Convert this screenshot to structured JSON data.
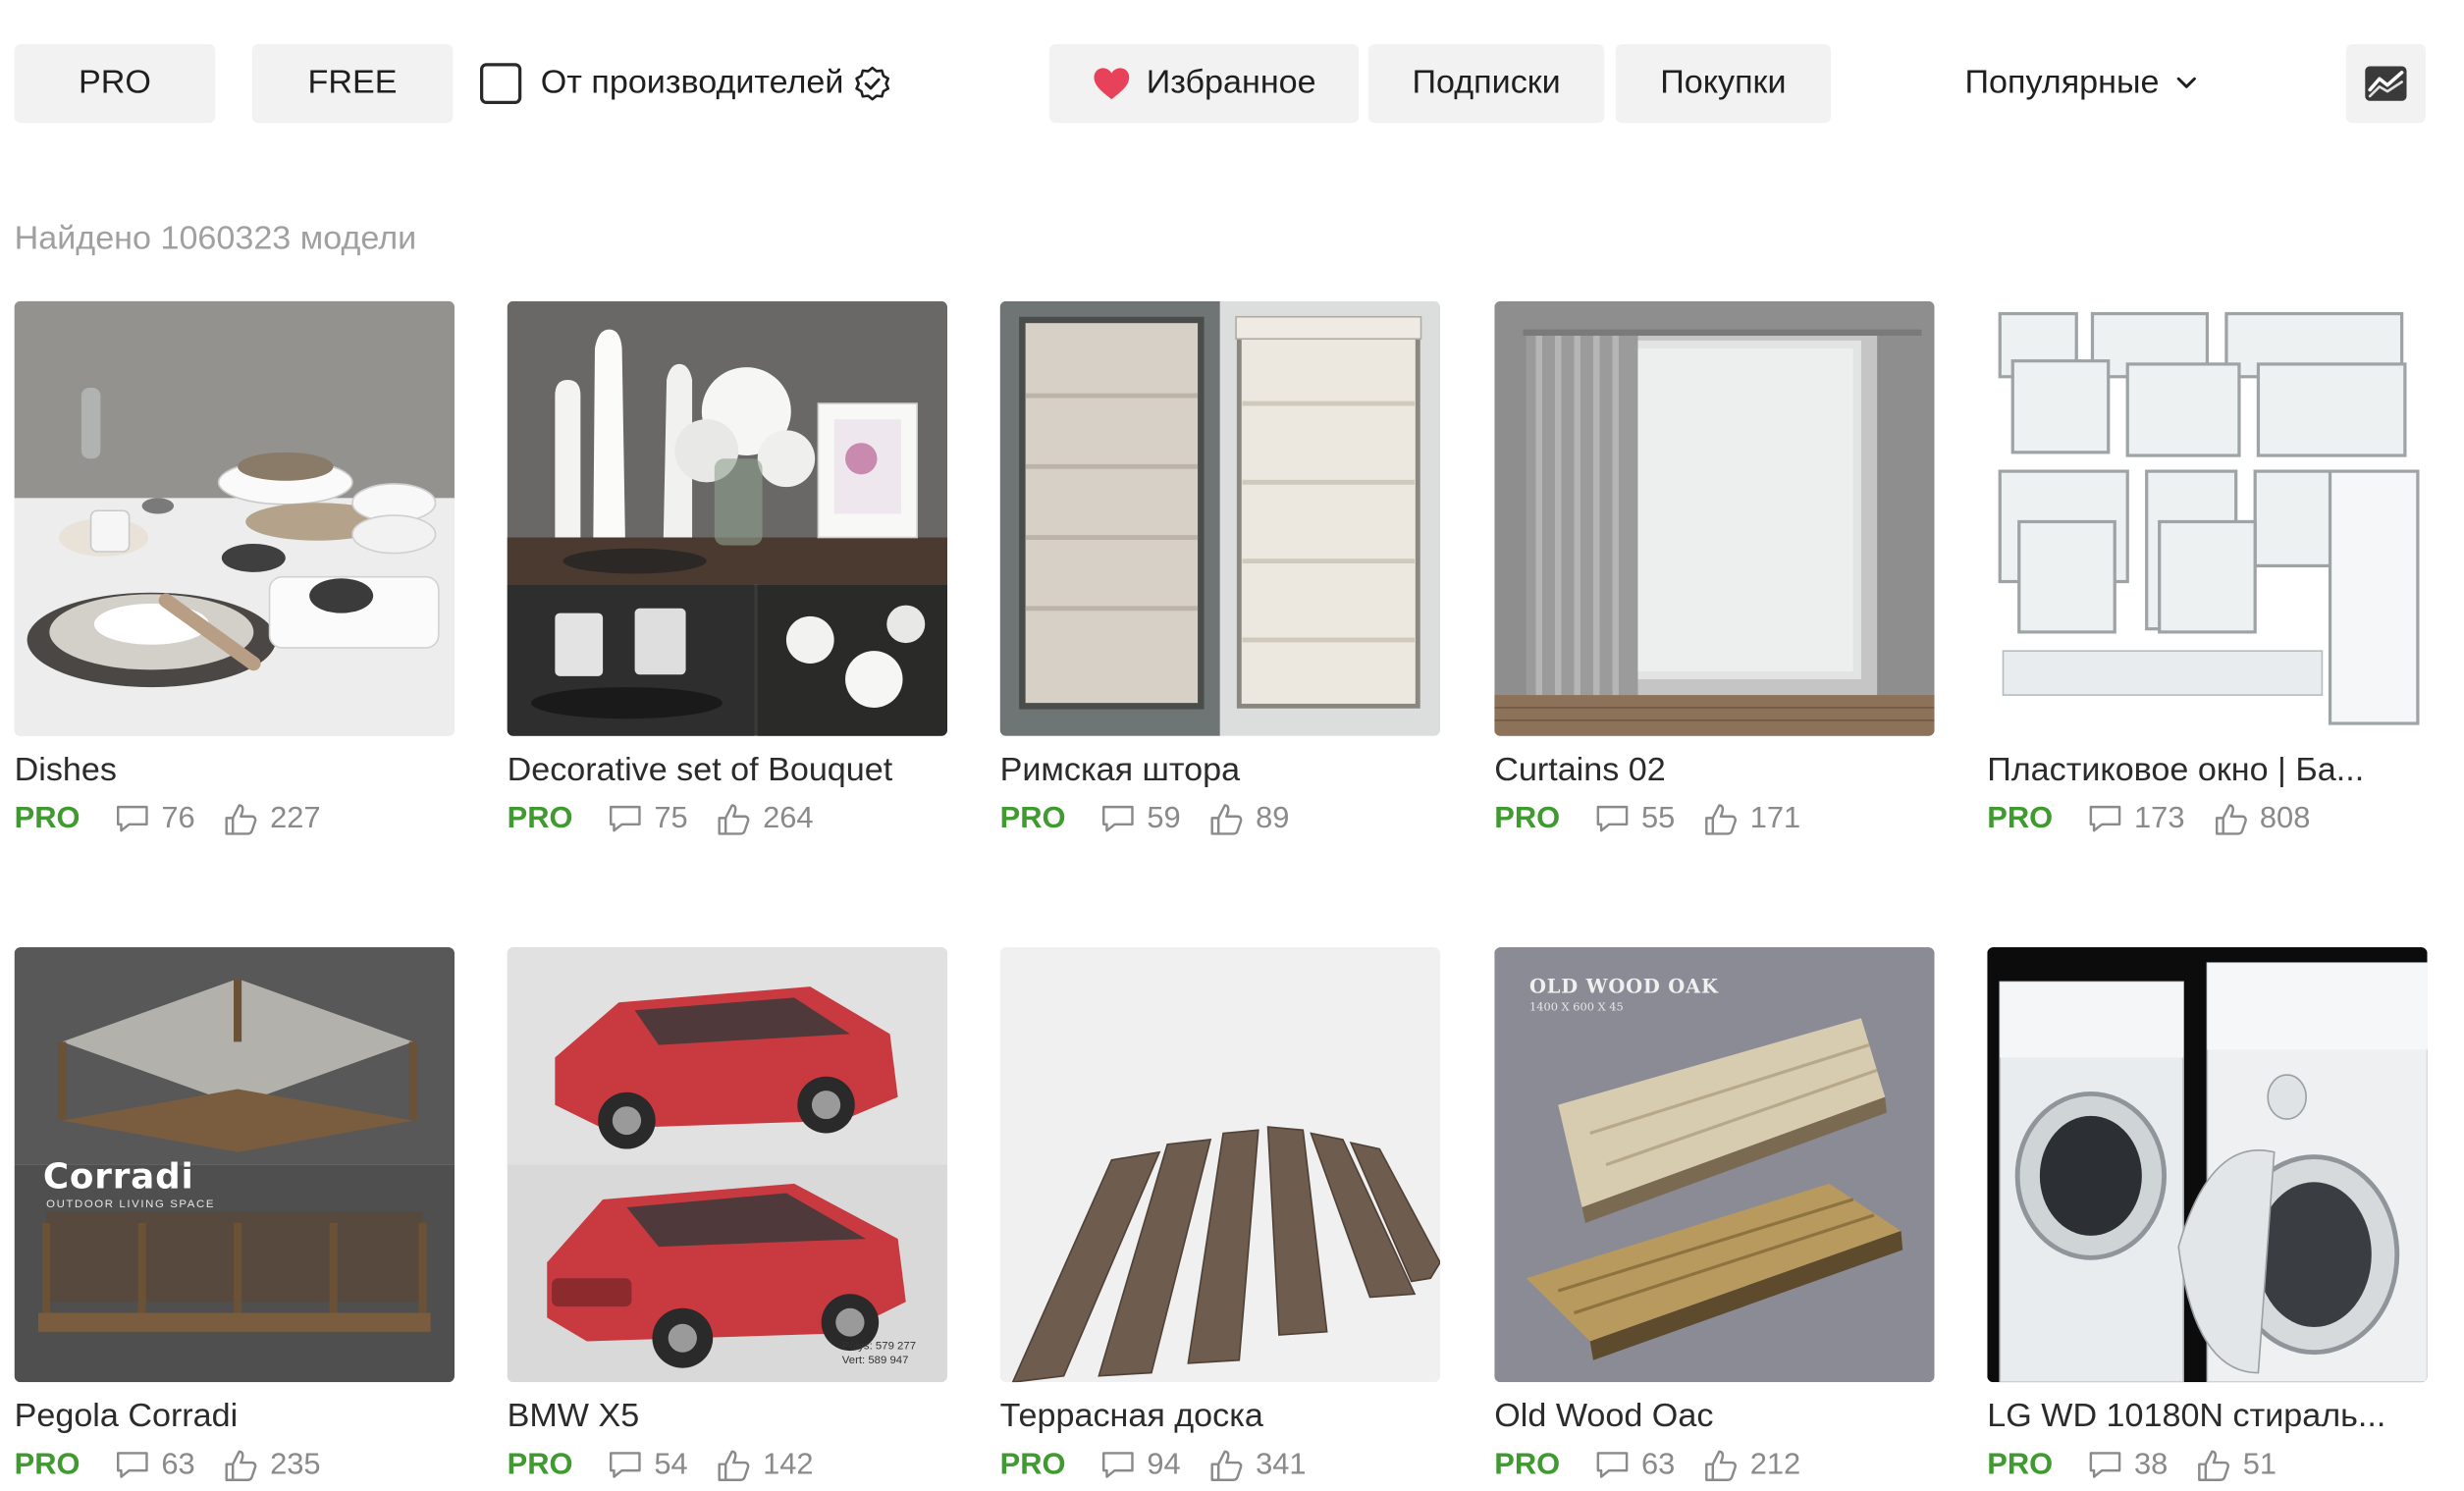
{
  "filters": {
    "pro_label": "PRO",
    "free_label": "FREE",
    "manufacturers_label": "От производителей",
    "favorites_label": "Избранное",
    "subscriptions_label": "Подписки",
    "purchases_label": "Покупки",
    "sort_label": "Популярные"
  },
  "results": {
    "found_text": "Найдено 1060323 модели"
  },
  "colors": {
    "accent_green": "#3f9a2f",
    "heart": "#e8415a",
    "button_bg": "#f2f2f2"
  },
  "cards": [
    {
      "title": "Dishes",
      "badge": "PRO",
      "comments": "76",
      "likes": "227"
    },
    {
      "title": "Decorative set of Bouquet",
      "badge": "PRO",
      "comments": "75",
      "likes": "264"
    },
    {
      "title": "Римская штора",
      "badge": "PRO",
      "comments": "59",
      "likes": "89"
    },
    {
      "title": "Curtains 02",
      "badge": "PRO",
      "comments": "55",
      "likes": "171"
    },
    {
      "title": "Пластиковое окно | Ба...",
      "badge": "PRO",
      "comments": "173",
      "likes": "808"
    },
    {
      "title": "Pegola Corradi",
      "badge": "PRO",
      "comments": "63",
      "likes": "235",
      "image_text": {
        "brand": "Corradi",
        "tagline": "OUTDOOR LIVING SPACE"
      }
    },
    {
      "title": "BMW X5",
      "badge": "PRO",
      "comments": "54",
      "likes": "142",
      "image_text": {
        "polys": "Polys: 579 277",
        "verts": "Vert: 589 947"
      }
    },
    {
      "title": "Террасная доска",
      "badge": "PRO",
      "comments": "94",
      "likes": "341"
    },
    {
      "title": "Old Wood Oac",
      "badge": "PRO",
      "comments": "63",
      "likes": "212",
      "image_text": {
        "heading": "OLD WOOD OAK",
        "dims": "1400 X 600 X 45"
      }
    },
    {
      "title": "LG WD 10180N стираль...",
      "badge": "PRO",
      "comments": "38",
      "likes": "51"
    }
  ]
}
